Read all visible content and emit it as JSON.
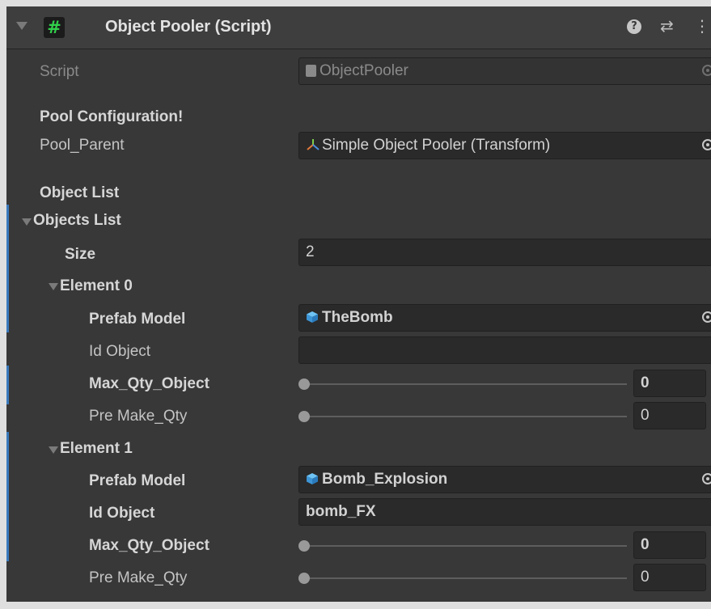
{
  "component": {
    "title": "Object Pooler (Script)",
    "script_label": "Script",
    "script_value": "ObjectPooler"
  },
  "header_icons": {
    "help": "?",
    "presets": "⇄",
    "menu": "⋮"
  },
  "pool": {
    "heading": "Pool Configuration!",
    "parent_label": "Pool_Parent",
    "parent_value": "Simple Object Pooler (Transform)"
  },
  "objects": {
    "heading": "Object List",
    "list_label": "Objects List",
    "size_label": "Size",
    "size_value": "2",
    "elements": [
      {
        "label": "Element 0",
        "prefab_label": "Prefab Model",
        "prefab_value": "TheBomb",
        "id_label": "Id Object",
        "id_value": "",
        "max_label": "Max_Qty_Object",
        "max_value": "0",
        "pre_label": "Pre Make_Qty",
        "pre_value": "0"
      },
      {
        "label": "Element 1",
        "prefab_label": "Prefab Model",
        "prefab_value": "Bomb_Explosion",
        "id_label": "Id Object",
        "id_value": "bomb_FX",
        "max_label": "Max_Qty_Object",
        "max_value": "0",
        "pre_label": "Pre Make_Qty",
        "pre_value": "0"
      }
    ]
  },
  "colors": {
    "panel": "#383838",
    "accent": "#3a79bb",
    "script_icon": "#31d04b"
  }
}
